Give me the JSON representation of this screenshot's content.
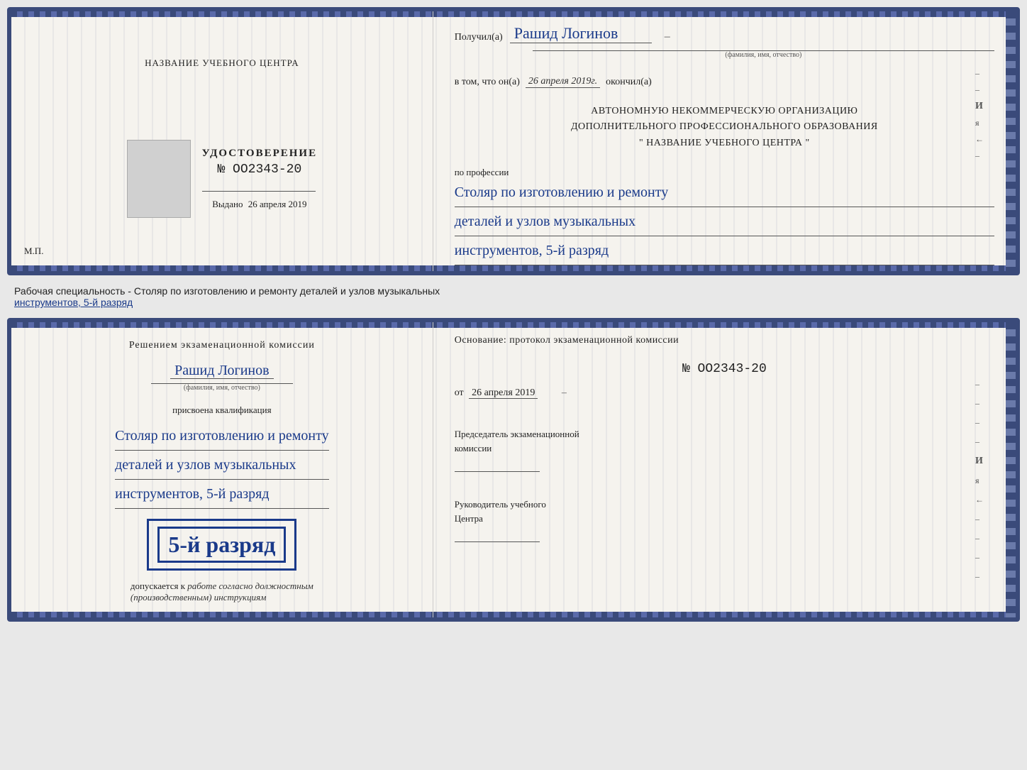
{
  "doc1": {
    "left": {
      "org_name_label": "НАЗВАНИЕ УЧЕБНОГО ЦЕНТРА",
      "udostoverenie_label": "УДОСТОВЕРЕНИЕ",
      "number": "№ OO2343-20",
      "vydano_label": "Выдано",
      "vydano_date": "26 апреля 2019",
      "photo_placeholder": "",
      "mp_label": "М.П."
    },
    "right": {
      "poluchil_label": "Получил(a)",
      "recipient_name": "Рашид Логинов",
      "fio_label": "(фамилия, имя, отчество)",
      "dash": "–",
      "vtom_label": "в том, что он(а)",
      "vtom_date": "26 апреля 2019г.",
      "okonchil_label": "окончил(а)",
      "org_line1": "АВТОНОМНУЮ НЕКОММЕРЧЕСКУЮ ОРГАНИЗАЦИЮ",
      "org_line2": "ДОПОЛНИТЕЛЬНОГО ПРОФЕССИОНАЛЬНОГО ОБРАЗОВАНИЯ",
      "org_line3": "\"  НАЗВАНИЕ УЧЕБНОГО ЦЕНТРА  \"",
      "i_label": "И",
      "ya_label": "я",
      "arrow_label": "←",
      "po_professii": "по профессии",
      "profession_line1": "Столяр по изготовлению и ремонту",
      "profession_line2": "деталей и узлов музыкальных",
      "profession_line3": "инструментов, 5-й разряд"
    }
  },
  "between": {
    "text_before": "Рабочая специальность - Столяр по изготовлению и ремонту деталей и узлов музыкальных",
    "text_underline": "инструментов, 5-й разряд"
  },
  "doc2": {
    "left": {
      "resheniem_line1": "Решением  экзаменационной  комиссии",
      "recipient_name": "Рашид Логинов",
      "fio_label": "(фамилия, имя, отчество)",
      "prisvoena_label": "присвоена квалификация",
      "profession_line1": "Столяр по изготовлению и ремонту",
      "profession_line2": "деталей и узлов музыкальных",
      "profession_line3": "инструментов, 5-й разряд",
      "rank_big": "5-й разряд",
      "dopuskaetsya_label": "допускается к",
      "dopuskaetsya_text": "работе согласно должностным",
      "dopuskaetsya_text2": "(производственным) инструкциям"
    },
    "right": {
      "osnovanie_label": "Основание: протокол экзаменационной  комиссии",
      "protocol_number": "№  OO2343-20",
      "ot_label": "от",
      "ot_date": "26 апреля 2019",
      "predsedatel_title": "Председатель экзаменационной",
      "predsedatel_subtitle": "комиссии",
      "rukovoditel_title": "Руководитель учебного",
      "rukovoditel_subtitle": "Центра",
      "i_label": "И",
      "ya_label": "я",
      "arrow_label": "←",
      "dashes": [
        "–",
        "–",
        "–",
        "–",
        "–",
        "–",
        "–",
        "–"
      ]
    }
  }
}
